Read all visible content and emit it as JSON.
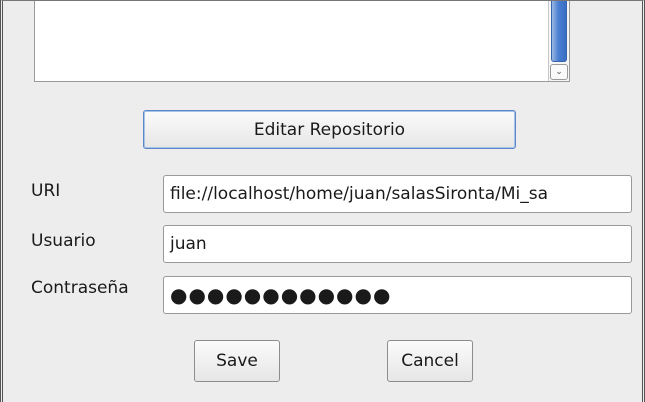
{
  "repository_list": {
    "scroll_down_glyph": "⌄"
  },
  "buttons": {
    "edit_repository": "Editar Repositorio",
    "save": "Save",
    "cancel": "Cancel"
  },
  "form": {
    "uri_label": "URI",
    "uri_value": "file://localhost/home/juan/salasSironta/Mi_sa",
    "user_label": "Usuario",
    "user_value": "juan",
    "password_label": "Contraseña",
    "password_mask": "●●●●●●●●●●●●"
  },
  "colors": {
    "window_bg": "#ededed",
    "scroll_thumb": "#4a7fd1",
    "focus_ring": "#5b86c9"
  }
}
